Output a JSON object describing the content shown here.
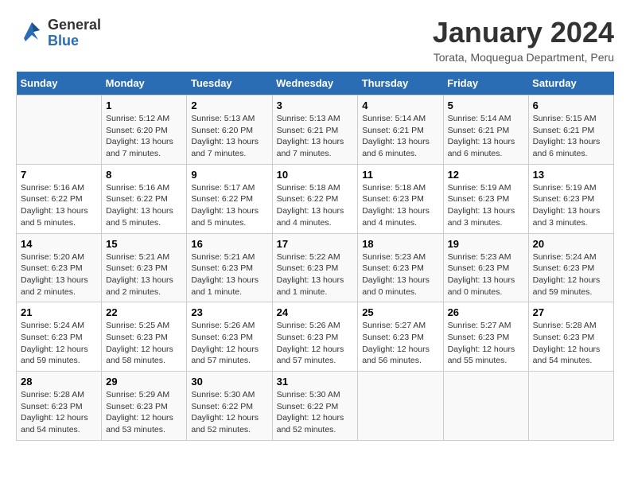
{
  "header": {
    "logo_general": "General",
    "logo_blue": "Blue",
    "month_year": "January 2024",
    "location": "Torata, Moquegua Department, Peru"
  },
  "weekdays": [
    "Sunday",
    "Monday",
    "Tuesday",
    "Wednesday",
    "Thursday",
    "Friday",
    "Saturday"
  ],
  "weeks": [
    [
      {
        "day": "",
        "info": ""
      },
      {
        "day": "1",
        "info": "Sunrise: 5:12 AM\nSunset: 6:20 PM\nDaylight: 13 hours\nand 7 minutes."
      },
      {
        "day": "2",
        "info": "Sunrise: 5:13 AM\nSunset: 6:20 PM\nDaylight: 13 hours\nand 7 minutes."
      },
      {
        "day": "3",
        "info": "Sunrise: 5:13 AM\nSunset: 6:21 PM\nDaylight: 13 hours\nand 7 minutes."
      },
      {
        "day": "4",
        "info": "Sunrise: 5:14 AM\nSunset: 6:21 PM\nDaylight: 13 hours\nand 6 minutes."
      },
      {
        "day": "5",
        "info": "Sunrise: 5:14 AM\nSunset: 6:21 PM\nDaylight: 13 hours\nand 6 minutes."
      },
      {
        "day": "6",
        "info": "Sunrise: 5:15 AM\nSunset: 6:21 PM\nDaylight: 13 hours\nand 6 minutes."
      }
    ],
    [
      {
        "day": "7",
        "info": "Sunrise: 5:16 AM\nSunset: 6:22 PM\nDaylight: 13 hours\nand 5 minutes."
      },
      {
        "day": "8",
        "info": "Sunrise: 5:16 AM\nSunset: 6:22 PM\nDaylight: 13 hours\nand 5 minutes."
      },
      {
        "day": "9",
        "info": "Sunrise: 5:17 AM\nSunset: 6:22 PM\nDaylight: 13 hours\nand 5 minutes."
      },
      {
        "day": "10",
        "info": "Sunrise: 5:18 AM\nSunset: 6:22 PM\nDaylight: 13 hours\nand 4 minutes."
      },
      {
        "day": "11",
        "info": "Sunrise: 5:18 AM\nSunset: 6:23 PM\nDaylight: 13 hours\nand 4 minutes."
      },
      {
        "day": "12",
        "info": "Sunrise: 5:19 AM\nSunset: 6:23 PM\nDaylight: 13 hours\nand 3 minutes."
      },
      {
        "day": "13",
        "info": "Sunrise: 5:19 AM\nSunset: 6:23 PM\nDaylight: 13 hours\nand 3 minutes."
      }
    ],
    [
      {
        "day": "14",
        "info": "Sunrise: 5:20 AM\nSunset: 6:23 PM\nDaylight: 13 hours\nand 2 minutes."
      },
      {
        "day": "15",
        "info": "Sunrise: 5:21 AM\nSunset: 6:23 PM\nDaylight: 13 hours\nand 2 minutes."
      },
      {
        "day": "16",
        "info": "Sunrise: 5:21 AM\nSunset: 6:23 PM\nDaylight: 13 hours\nand 1 minute."
      },
      {
        "day": "17",
        "info": "Sunrise: 5:22 AM\nSunset: 6:23 PM\nDaylight: 13 hours\nand 1 minute."
      },
      {
        "day": "18",
        "info": "Sunrise: 5:23 AM\nSunset: 6:23 PM\nDaylight: 13 hours\nand 0 minutes."
      },
      {
        "day": "19",
        "info": "Sunrise: 5:23 AM\nSunset: 6:23 PM\nDaylight: 13 hours\nand 0 minutes."
      },
      {
        "day": "20",
        "info": "Sunrise: 5:24 AM\nSunset: 6:23 PM\nDaylight: 12 hours\nand 59 minutes."
      }
    ],
    [
      {
        "day": "21",
        "info": "Sunrise: 5:24 AM\nSunset: 6:23 PM\nDaylight: 12 hours\nand 59 minutes."
      },
      {
        "day": "22",
        "info": "Sunrise: 5:25 AM\nSunset: 6:23 PM\nDaylight: 12 hours\nand 58 minutes."
      },
      {
        "day": "23",
        "info": "Sunrise: 5:26 AM\nSunset: 6:23 PM\nDaylight: 12 hours\nand 57 minutes."
      },
      {
        "day": "24",
        "info": "Sunrise: 5:26 AM\nSunset: 6:23 PM\nDaylight: 12 hours\nand 57 minutes."
      },
      {
        "day": "25",
        "info": "Sunrise: 5:27 AM\nSunset: 6:23 PM\nDaylight: 12 hours\nand 56 minutes."
      },
      {
        "day": "26",
        "info": "Sunrise: 5:27 AM\nSunset: 6:23 PM\nDaylight: 12 hours\nand 55 minutes."
      },
      {
        "day": "27",
        "info": "Sunrise: 5:28 AM\nSunset: 6:23 PM\nDaylight: 12 hours\nand 54 minutes."
      }
    ],
    [
      {
        "day": "28",
        "info": "Sunrise: 5:28 AM\nSunset: 6:23 PM\nDaylight: 12 hours\nand 54 minutes."
      },
      {
        "day": "29",
        "info": "Sunrise: 5:29 AM\nSunset: 6:23 PM\nDaylight: 12 hours\nand 53 minutes."
      },
      {
        "day": "30",
        "info": "Sunrise: 5:30 AM\nSunset: 6:22 PM\nDaylight: 12 hours\nand 52 minutes."
      },
      {
        "day": "31",
        "info": "Sunrise: 5:30 AM\nSunset: 6:22 PM\nDaylight: 12 hours\nand 52 minutes."
      },
      {
        "day": "",
        "info": ""
      },
      {
        "day": "",
        "info": ""
      },
      {
        "day": "",
        "info": ""
      }
    ]
  ]
}
